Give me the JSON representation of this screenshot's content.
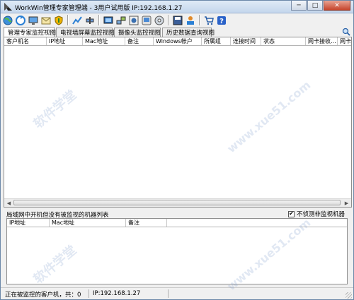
{
  "window": {
    "title": "WorkWin管理专家管理端 - 3用户试用版 IP:192.168.1.27",
    "min_label": "─",
    "max_label": "□",
    "close_label": "✕"
  },
  "toolbar": {
    "icons": [
      "globe-icon",
      "refresh-icon",
      "monitor-icon",
      "mail-icon",
      "shield-icon",
      "chart-icon",
      "tools-icon",
      "screen-icon",
      "network-icon",
      "camera-icon",
      "windows-icon",
      "disk-icon",
      "save-icon",
      "user-icon",
      "cart-icon",
      "help-icon"
    ]
  },
  "tabs": [
    {
      "label": "管理专家监控视图",
      "active": true
    },
    {
      "label": "电视墙屏幕监控视图",
      "active": false
    },
    {
      "label": "摄像头监控视图",
      "active": false
    },
    {
      "label": "历史数据查询视图",
      "active": false
    }
  ],
  "clients_table": {
    "columns": [
      "客户机名",
      "IP地址",
      "Mac地址",
      "备注",
      "Windows帐户",
      "所属组",
      "连接时间",
      "状态",
      "网卡接收...",
      "网卡"
    ],
    "rows": []
  },
  "unmonitored": {
    "title": "局域网中开机但没有被监视的机器列表",
    "checkbox_label": "不侦测非监视机器",
    "checkbox_checked": true,
    "columns": [
      "IP地址",
      "Mac地址",
      "备注"
    ],
    "rows": []
  },
  "status": {
    "monitored_count_text": "正在被监控的客户机，共：0",
    "ip_text": "IP:192.168.1.27"
  },
  "watermark": {
    "text1": "软件学堂",
    "text2": "www.xue51.com"
  },
  "colors": {
    "titlebar": "#c4d6ec",
    "close_button": "#c6452c",
    "watermark": "#7896c8"
  }
}
